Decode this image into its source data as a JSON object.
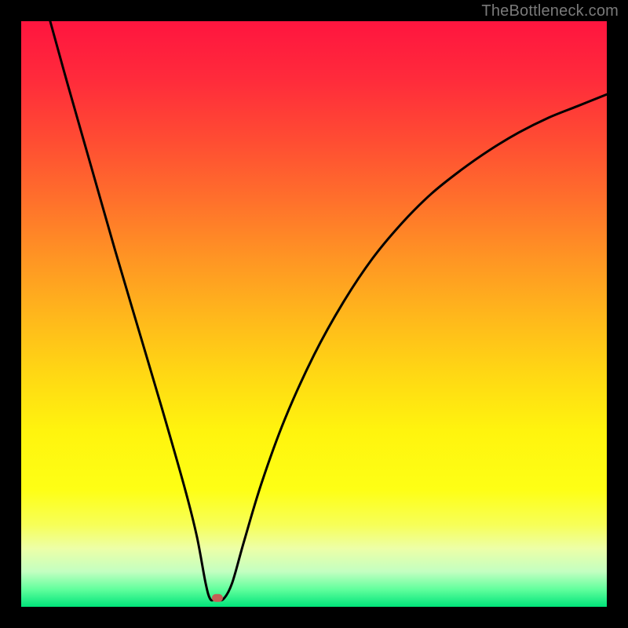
{
  "watermark": {
    "text": "TheBottleneck.com"
  },
  "chart_data": {
    "type": "line",
    "title": "",
    "xlabel": "",
    "ylabel": "",
    "x_range": [
      0,
      100
    ],
    "y_range": [
      0,
      100
    ],
    "background": {
      "type": "vertical_gradient",
      "stops": [
        {
          "pos": 0.0,
          "color": "#ff153f"
        },
        {
          "pos": 0.1,
          "color": "#ff2b3b"
        },
        {
          "pos": 0.2,
          "color": "#ff4b33"
        },
        {
          "pos": 0.3,
          "color": "#ff6e2c"
        },
        {
          "pos": 0.4,
          "color": "#ff9324"
        },
        {
          "pos": 0.5,
          "color": "#ffb61c"
        },
        {
          "pos": 0.6,
          "color": "#ffd714"
        },
        {
          "pos": 0.7,
          "color": "#fff40e"
        },
        {
          "pos": 0.8,
          "color": "#feff15"
        },
        {
          "pos": 0.86,
          "color": "#f7ff58"
        },
        {
          "pos": 0.9,
          "color": "#edffa7"
        },
        {
          "pos": 0.94,
          "color": "#c3ffc1"
        },
        {
          "pos": 0.97,
          "color": "#62ff9d"
        },
        {
          "pos": 1.0,
          "color": "#00e47a"
        }
      ]
    },
    "curve_color": "#000000",
    "marker": {
      "x": 33.5,
      "y": 1.5,
      "color": "#c45f55"
    },
    "series": [
      {
        "name": "bottleneck-curve",
        "points": [
          {
            "x": 4.95,
            "y": 100.0
          },
          {
            "x": 8.0,
            "y": 89.0
          },
          {
            "x": 12.0,
            "y": 75.0
          },
          {
            "x": 16.0,
            "y": 61.0
          },
          {
            "x": 20.0,
            "y": 47.5
          },
          {
            "x": 24.0,
            "y": 34.0
          },
          {
            "x": 28.0,
            "y": 20.0
          },
          {
            "x": 30.0,
            "y": 12.0
          },
          {
            "x": 31.5,
            "y": 4.0
          },
          {
            "x": 32.3,
            "y": 1.3
          },
          {
            "x": 33.2,
            "y": 1.3
          },
          {
            "x": 34.5,
            "y": 1.3
          },
          {
            "x": 36.0,
            "y": 4.0
          },
          {
            "x": 38.0,
            "y": 11.0
          },
          {
            "x": 41.0,
            "y": 21.0
          },
          {
            "x": 45.0,
            "y": 32.0
          },
          {
            "x": 50.0,
            "y": 43.0
          },
          {
            "x": 55.0,
            "y": 52.0
          },
          {
            "x": 60.0,
            "y": 59.5
          },
          {
            "x": 65.0,
            "y": 65.5
          },
          {
            "x": 70.0,
            "y": 70.5
          },
          {
            "x": 75.0,
            "y": 74.5
          },
          {
            "x": 80.0,
            "y": 78.0
          },
          {
            "x": 85.0,
            "y": 81.0
          },
          {
            "x": 90.0,
            "y": 83.5
          },
          {
            "x": 95.0,
            "y": 85.5
          },
          {
            "x": 100.0,
            "y": 87.5
          }
        ]
      }
    ]
  }
}
